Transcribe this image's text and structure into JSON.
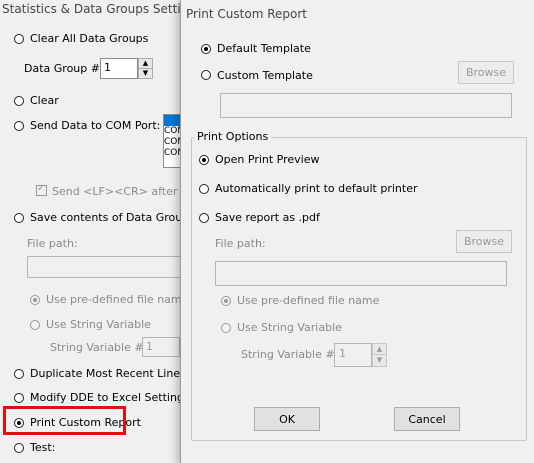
{
  "bg_window": {
    "title": "Statistics & Data Groups Settings",
    "clear_all": "Clear All Data Groups",
    "data_group_label": "Data Group #:",
    "data_group_value": "1",
    "clear": "Clear",
    "send_com": "Send Data to COM Port:",
    "com_items": [
      "COM",
      "COM",
      "COM"
    ],
    "send_lf": "Send <LF><CR> after each",
    "save_contents": "Save contents of Data Group to",
    "file_path": "File path:",
    "use_predef": "Use pre-defined file name",
    "use_string": "Use String Variable",
    "string_var": "String Variable #",
    "string_var_value": "1",
    "duplicate": "Duplicate Most Recent Line",
    "modify_dde": "Modify DDE to Excel Settings",
    "print_custom": "Print Custom Report",
    "test": "Test:",
    "highlight_color": "#e01010"
  },
  "dialog": {
    "title": "Print Custom Report",
    "default_template": "Default Template",
    "custom_template": "Custom Template",
    "browse1": "Browse",
    "print_options": "Print Options",
    "open_preview": "Open Print Preview",
    "auto_print": "Automatically print to default printer",
    "save_pdf": "Save report as .pdf",
    "file_path": "File path:",
    "browse2": "Browse",
    "use_predef": "Use pre-defined file name",
    "use_string": "Use String Variable",
    "string_var": "String Variable #",
    "string_var_value": "1",
    "ok": "OK",
    "cancel": "Cancel"
  }
}
